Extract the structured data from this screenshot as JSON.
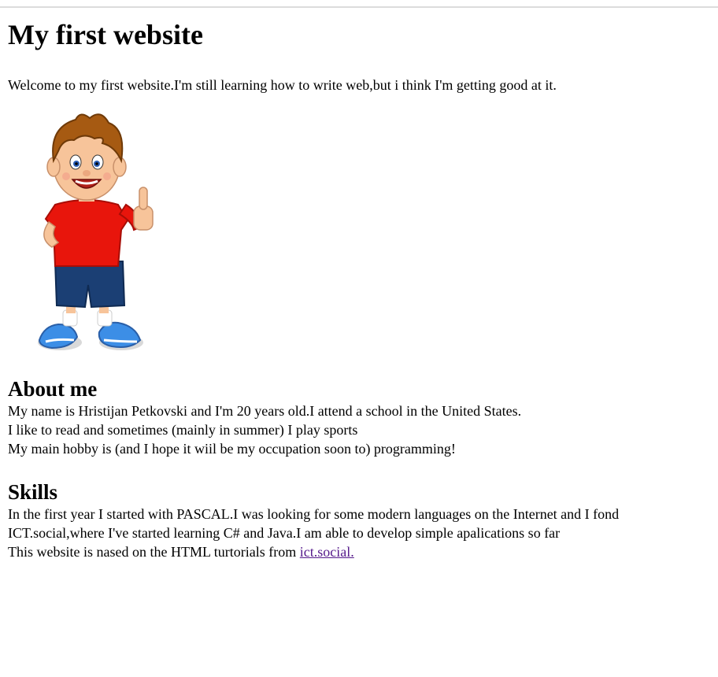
{
  "page": {
    "heading": "My first website",
    "intro": "Welcome to my first website.I'm still learning how to write web,but i think I'm getting good at it."
  },
  "about": {
    "title": "About me",
    "paragraphs": [
      "My name is Hristijan Petkovski and I'm 20 years old.I attend a school in the United States.",
      "I like to read and sometimes (mainly in summer) I play sports",
      "My main hobby is (and I hope it wiil be my occupation soon to) programming!"
    ]
  },
  "skills": {
    "title": "Skills",
    "paragraph": "In the first year I started with PASCAL.I was looking for some modern languages on the Internet and I fond ICT.social,where I've started learning C# and Java.I am able to develop simple apalications so far",
    "footer_text": "This website is nased on the HTML turtorials from ",
    "footer_link": "ict.social."
  },
  "image": {
    "icon": "cartoon-boy-thumbs-up"
  },
  "colors": {
    "link": "#551a8b",
    "shirt": "#e8150c",
    "shorts": "#1b3f74",
    "hair": "#a65a12",
    "skin": "#f7c49a"
  }
}
